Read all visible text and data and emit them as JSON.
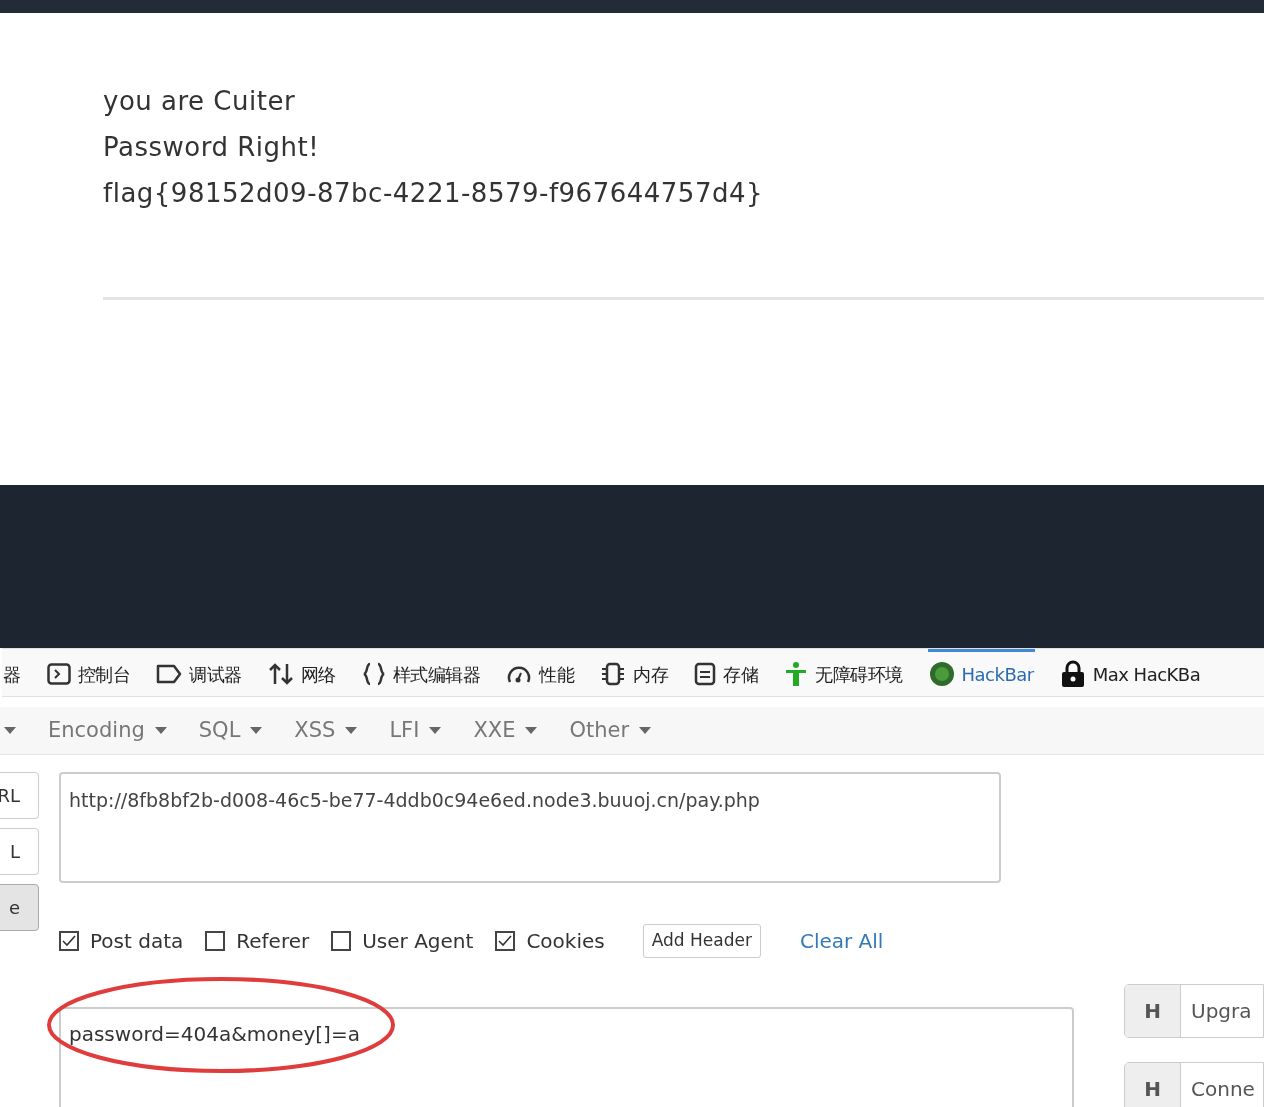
{
  "page": {
    "lines": [
      "you are Cuiter",
      "Password Right!",
      "flag{98152d09-87bc-4221-8579-f967644757d4}"
    ]
  },
  "devtools_tabs": [
    {
      "label": "器",
      "kind": "none",
      "selected": false
    },
    {
      "label": "控制台",
      "kind": "console",
      "selected": false
    },
    {
      "label": "调试器",
      "kind": "debugger",
      "selected": false
    },
    {
      "label": "网络",
      "kind": "network",
      "selected": false
    },
    {
      "label": "样式编辑器",
      "kind": "style",
      "selected": false
    },
    {
      "label": "性能",
      "kind": "performance",
      "selected": false
    },
    {
      "label": "内存",
      "kind": "memory",
      "selected": false
    },
    {
      "label": "存储",
      "kind": "storage",
      "selected": false
    },
    {
      "label": "无障碍环境",
      "kind": "accessibility",
      "selected": false
    },
    {
      "label": "HackBar",
      "kind": "hackbar",
      "selected": true
    },
    {
      "label": "Max HacKBa",
      "kind": "lock",
      "selected": false
    }
  ],
  "hackbar": {
    "menus": [
      "Encoding",
      "SQL",
      "XSS",
      "LFI",
      "XXE",
      "Other"
    ],
    "side_buttons": [
      {
        "label": "RL",
        "pressed": false
      },
      {
        "label": "L",
        "pressed": false
      },
      {
        "label": "e",
        "pressed": true
      }
    ],
    "url": "http://8fb8bf2b-d008-46c5-be77-4ddb0c94e6ed.node3.buuoj.cn/pay.php",
    "options": [
      {
        "label": "Post data",
        "checked": true
      },
      {
        "label": "Referer",
        "checked": false
      },
      {
        "label": "User Agent",
        "checked": false
      },
      {
        "label": "Cookies",
        "checked": true
      }
    ],
    "add_header": "Add Header",
    "clear_all": "Clear All",
    "post_data": "password=404a&money[]=a",
    "headers": [
      {
        "badge": "H",
        "value": "Upgra"
      },
      {
        "badge": "H",
        "value": "Conne"
      }
    ]
  }
}
